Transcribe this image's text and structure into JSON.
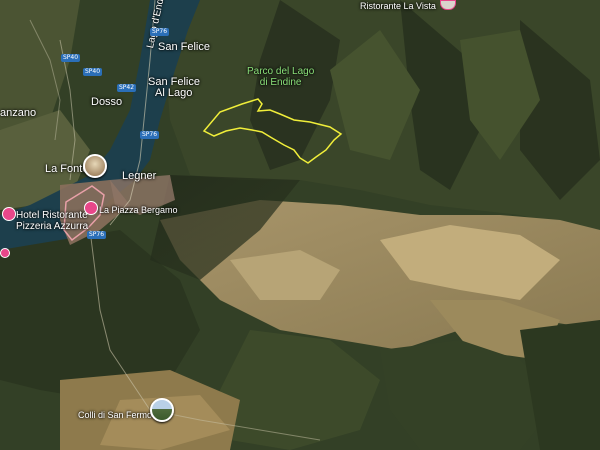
{
  "map": {
    "type": "satellite",
    "places": {
      "lago_label": "Lago d'Endine",
      "san_felice": "San Felice",
      "san_felice_al_lago_1": "San Felice",
      "san_felice_al_lago_2": "Al Lago",
      "dosso": "Dosso",
      "anzano": "anzano",
      "la_fonte": "La Fonte",
      "legner": "Legner",
      "hotel_1": "Hotel Ristorante",
      "hotel_2": "Pizzeria Azzurra",
      "la_piazza": "La Piazza Bergamo",
      "colli": "Colli di San Fermo",
      "top_label": "Ristorante La Vista"
    },
    "park": {
      "line1": "Parco del Lago",
      "line2": "di Endine",
      "outline_color": "#f0ee3a"
    },
    "roads": {
      "sp40_a": "SP40",
      "sp40_b": "SP40",
      "sp42": "SP42",
      "sp76_a": "SP76",
      "sp76_b": "SP76",
      "sp76_c": "SP76"
    },
    "colors": {
      "lake": "#1d3f4c",
      "forest": "#2f3b22",
      "fields": "#b09a6a",
      "poi_pin": "#e8478a",
      "shield": "#2b6fb8"
    },
    "icons": [
      "restaurant-pin-icon",
      "hotel-pin-icon",
      "photo-pin-icon",
      "road-shield-icon"
    ]
  }
}
